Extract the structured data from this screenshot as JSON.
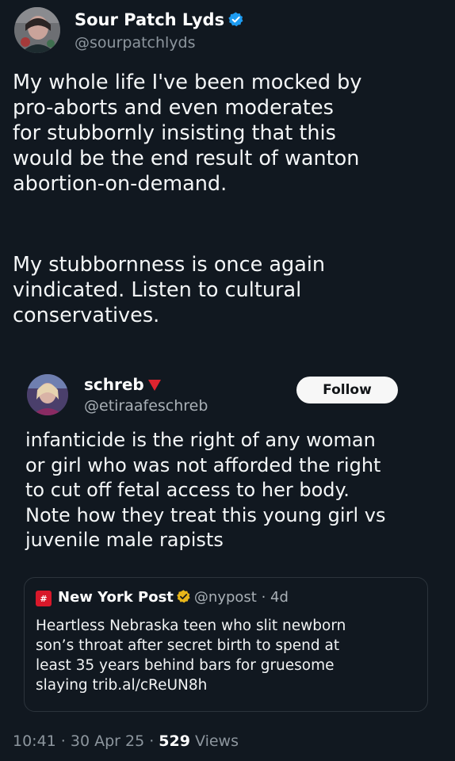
{
  "author": {
    "name": "Sour Patch Lyds",
    "handle": "@sourpatchlyds"
  },
  "tweet": {
    "paragraph1": [
      "My whole life I've been mocked by",
      "pro-aborts and even moderates",
      "for stubbornly insisting that this",
      "would be the end result of wanton",
      "abortion-on-demand."
    ],
    "paragraph2": [
      "My stubbornness is once again",
      "vindicated. Listen to cultural",
      "conservatives."
    ]
  },
  "embedded": {
    "name": "schreb",
    "handle": "@etiraafeschreb",
    "follow_label": "Follow",
    "lines": [
      "infanticide is the right of any woman",
      "or girl who was not afforded the right",
      "to cut off fetal access to her body.",
      "Note how they treat this young girl vs",
      "juvenile male rapists"
    ],
    "quoted": {
      "logo_text": "#",
      "name": "New York Post",
      "meta": "@nypost · 4d",
      "lines": [
        "Heartless Nebraska teen who slit newborn",
        "son’s throat after secret birth to spend at",
        "least 35 years behind bars for gruesome",
        "slaying trib.al/cReUN8h"
      ]
    }
  },
  "footer": {
    "time": "10:41 · 30 Apr 25 · ",
    "views_count": "529",
    "views_label": " Views"
  },
  "colors": {
    "background": "#111820",
    "verified_blue": "#1d9bf0",
    "gold": "#e8b61a",
    "red_triangle": "#e0242f"
  }
}
